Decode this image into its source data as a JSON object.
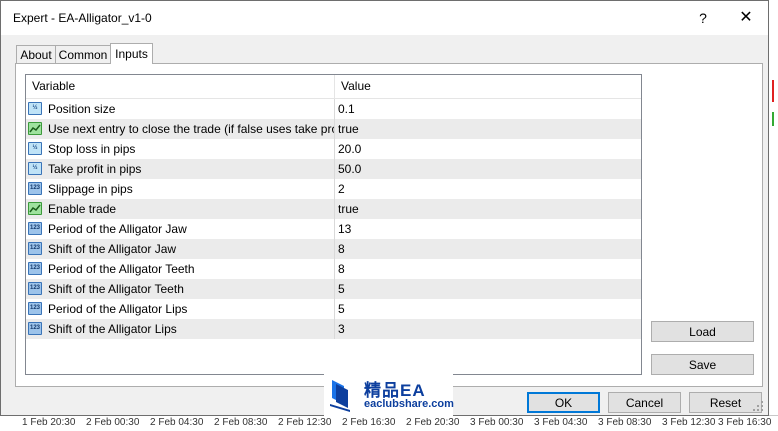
{
  "window": {
    "title": "Expert - EA-Alligator_v1-0",
    "help_glyph": "?",
    "close_glyph": "✕"
  },
  "tabs": [
    {
      "label": "About",
      "active": false
    },
    {
      "label": "Common",
      "active": false
    },
    {
      "label": "Inputs",
      "active": true
    }
  ],
  "grid": {
    "columns": [
      "Variable",
      "Value"
    ],
    "rows": [
      {
        "type": "double",
        "icon": "double-type-icon",
        "icon_text": "½",
        "variable": "Position size",
        "value": "0.1"
      },
      {
        "type": "bool",
        "icon": "bool-type-icon",
        "icon_text": "",
        "variable": "Use next entry to close the trade (if false uses take profit)",
        "value": "true"
      },
      {
        "type": "double",
        "icon": "double-type-icon",
        "icon_text": "½",
        "variable": "Stop loss in pips",
        "value": "20.0"
      },
      {
        "type": "double",
        "icon": "double-type-icon",
        "icon_text": "½",
        "variable": "Take profit in pips",
        "value": "50.0"
      },
      {
        "type": "int",
        "icon": "integer-type-icon",
        "icon_text": "123",
        "variable": "Slippage in pips",
        "value": "2"
      },
      {
        "type": "bool",
        "icon": "bool-type-icon",
        "icon_text": "",
        "variable": "Enable trade",
        "value": "true"
      },
      {
        "type": "int",
        "icon": "integer-type-icon",
        "icon_text": "123",
        "variable": "Period of the Alligator Jaw",
        "value": "13"
      },
      {
        "type": "int",
        "icon": "integer-type-icon",
        "icon_text": "123",
        "variable": "Shift of the Alligator Jaw",
        "value": "8"
      },
      {
        "type": "int",
        "icon": "integer-type-icon",
        "icon_text": "123",
        "variable": "Period of the Alligator Teeth",
        "value": "8"
      },
      {
        "type": "int",
        "icon": "integer-type-icon",
        "icon_text": "123",
        "variable": "Shift of the Alligator Teeth",
        "value": "5"
      },
      {
        "type": "int",
        "icon": "integer-type-icon",
        "icon_text": "123",
        "variable": "Period of the Alligator Lips",
        "value": "5"
      },
      {
        "type": "int",
        "icon": "integer-type-icon",
        "icon_text": "123",
        "variable": "Shift of the Alligator Lips",
        "value": "3"
      }
    ]
  },
  "buttons": {
    "load": "Load",
    "save": "Save",
    "ok": "OK",
    "cancel": "Cancel",
    "reset": "Reset"
  },
  "watermark": {
    "title": "精品EA",
    "subtitle": "eaclubshare.com"
  },
  "chart_axis": {
    "labels": [
      "1 Feb 20:30",
      "2 Feb 00:30",
      "2 Feb 04:30",
      "2 Feb 08:30",
      "2 Feb 12:30",
      "2 Feb 16:30",
      "2 Feb 20:30",
      "3 Feb 00:30",
      "3 Feb 04:30",
      "3 Feb 08:30",
      "3 Feb 12:30",
      "3 Feb 16:30"
    ]
  },
  "colors": {
    "accent_border": "#0078d7",
    "bull_candle": "#33aa33",
    "bear_candle": "#e02020"
  }
}
